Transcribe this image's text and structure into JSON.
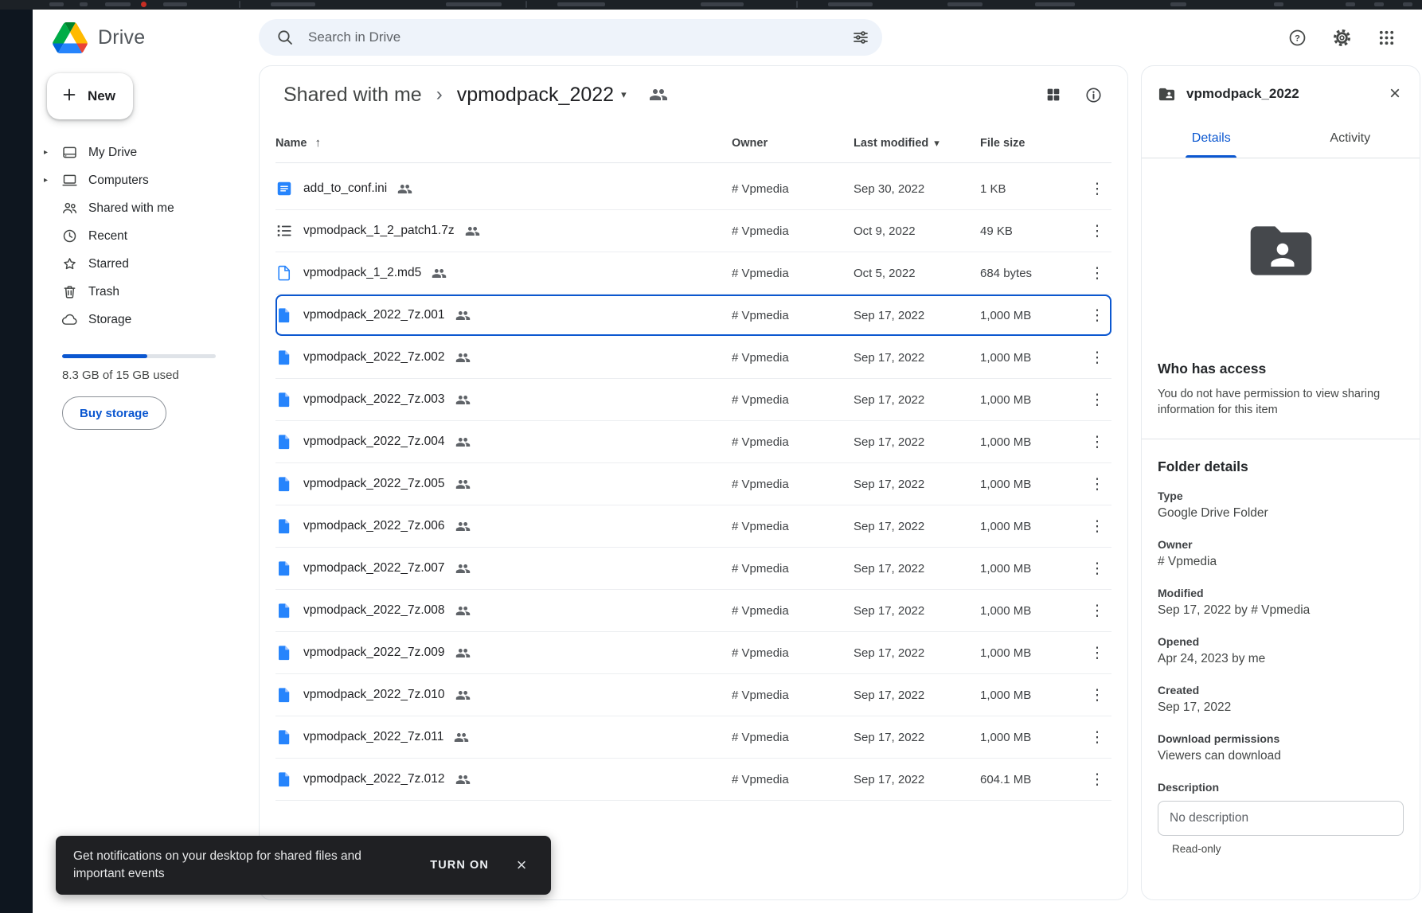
{
  "header": {
    "brand": "Drive",
    "search_placeholder": "Search in Drive"
  },
  "sidebar": {
    "new_button": "New",
    "items": [
      {
        "key": "my-drive",
        "label": "My Drive",
        "icon": "my-drive",
        "expandable": true
      },
      {
        "key": "computers",
        "label": "Computers",
        "icon": "computers",
        "expandable": true
      },
      {
        "key": "shared-with-me",
        "label": "Shared with me",
        "icon": "shared",
        "expandable": false
      },
      {
        "key": "recent",
        "label": "Recent",
        "icon": "recent",
        "expandable": false
      },
      {
        "key": "starred",
        "label": "Starred",
        "icon": "starred",
        "expandable": false
      },
      {
        "key": "trash",
        "label": "Trash",
        "icon": "trash",
        "expandable": false
      },
      {
        "key": "storage",
        "label": "Storage",
        "icon": "storage",
        "expandable": false
      }
    ],
    "storage_fraction": 0.553,
    "storage_text": "8.3 GB of 15 GB used",
    "buy_storage": "Buy storage"
  },
  "breadcrumb": {
    "parent": "Shared with me",
    "current": "vpmodpack_2022"
  },
  "table": {
    "columns": [
      "Name",
      "Owner",
      "Last modified",
      "File size"
    ],
    "rows": [
      {
        "name": "add_to_conf.ini",
        "icon": "doc-lines",
        "shared": true,
        "owner": "# Vpmedia",
        "modified": "Sep 30, 2022",
        "size": "1 KB",
        "selected": false
      },
      {
        "name": "vpmodpack_1_2_patch1.7z",
        "icon": "list",
        "shared": true,
        "owner": "# Vpmedia",
        "modified": "Oct 9, 2022",
        "size": "49 KB",
        "selected": false
      },
      {
        "name": "vpmodpack_1_2.md5",
        "icon": "file-outline",
        "shared": true,
        "owner": "# Vpmedia",
        "modified": "Oct 5, 2022",
        "size": "684 bytes",
        "selected": false
      },
      {
        "name": "vpmodpack_2022_7z.001",
        "icon": "file-solid",
        "shared": true,
        "owner": "# Vpmedia",
        "modified": "Sep 17, 2022",
        "size": "1,000 MB",
        "selected": true
      },
      {
        "name": "vpmodpack_2022_7z.002",
        "icon": "file-solid",
        "shared": true,
        "owner": "# Vpmedia",
        "modified": "Sep 17, 2022",
        "size": "1,000 MB",
        "selected": false
      },
      {
        "name": "vpmodpack_2022_7z.003",
        "icon": "file-solid",
        "shared": true,
        "owner": "# Vpmedia",
        "modified": "Sep 17, 2022",
        "size": "1,000 MB",
        "selected": false
      },
      {
        "name": "vpmodpack_2022_7z.004",
        "icon": "file-solid",
        "shared": true,
        "owner": "# Vpmedia",
        "modified": "Sep 17, 2022",
        "size": "1,000 MB",
        "selected": false
      },
      {
        "name": "vpmodpack_2022_7z.005",
        "icon": "file-solid",
        "shared": true,
        "owner": "# Vpmedia",
        "modified": "Sep 17, 2022",
        "size": "1,000 MB",
        "selected": false
      },
      {
        "name": "vpmodpack_2022_7z.006",
        "icon": "file-solid",
        "shared": true,
        "owner": "# Vpmedia",
        "modified": "Sep 17, 2022",
        "size": "1,000 MB",
        "selected": false
      },
      {
        "name": "vpmodpack_2022_7z.007",
        "icon": "file-solid",
        "shared": true,
        "owner": "# Vpmedia",
        "modified": "Sep 17, 2022",
        "size": "1,000 MB",
        "selected": false
      },
      {
        "name": "vpmodpack_2022_7z.008",
        "icon": "file-solid",
        "shared": true,
        "owner": "# Vpmedia",
        "modified": "Sep 17, 2022",
        "size": "1,000 MB",
        "selected": false
      },
      {
        "name": "vpmodpack_2022_7z.009",
        "icon": "file-solid",
        "shared": true,
        "owner": "# Vpmedia",
        "modified": "Sep 17, 2022",
        "size": "1,000 MB",
        "selected": false
      },
      {
        "name": "vpmodpack_2022_7z.010",
        "icon": "file-solid",
        "shared": true,
        "owner": "# Vpmedia",
        "modified": "Sep 17, 2022",
        "size": "1,000 MB",
        "selected": false
      },
      {
        "name": "vpmodpack_2022_7z.011",
        "icon": "file-solid",
        "shared": true,
        "owner": "# Vpmedia",
        "modified": "Sep 17, 2022",
        "size": "1,000 MB",
        "selected": false
      },
      {
        "name": "vpmodpack_2022_7z.012",
        "icon": "file-solid",
        "shared": true,
        "owner": "# Vpmedia",
        "modified": "Sep 17, 2022",
        "size": "604.1 MB",
        "selected": false
      }
    ]
  },
  "panel": {
    "title": "vpmodpack_2022",
    "tabs": [
      {
        "label": "Details",
        "active": true
      },
      {
        "label": "Activity",
        "active": false
      }
    ],
    "who_has_access": "Who has access",
    "access_message": "You do not have permission to view sharing information for this item",
    "folder_details_heading": "Folder details",
    "fields": [
      {
        "label": "Type",
        "value": "Google Drive Folder"
      },
      {
        "label": "Owner",
        "value": "# Vpmedia"
      },
      {
        "label": "Modified",
        "value": "Sep 17, 2022 by # Vpmedia"
      },
      {
        "label": "Opened",
        "value": "Apr 24, 2023 by me"
      },
      {
        "label": "Created",
        "value": "Sep 17, 2022"
      },
      {
        "label": "Download permissions",
        "value": "Viewers can download"
      }
    ],
    "description_label": "Description",
    "description_placeholder": "No description",
    "read_only": "Read-only"
  },
  "toast": {
    "message": "Get notifications on your desktop for shared files and important events",
    "action": "TURN ON"
  },
  "glyphs": {
    "sort_asc": "↑",
    "caret_down": "▾",
    "chevron_right": "▸",
    "crumb_separator": "›",
    "more_vertical": "⋮",
    "close": "×"
  },
  "colors": {
    "accent": "#0b57d0",
    "file_icon_blue": "#2684fc",
    "selected_outline": "#0b57d0",
    "toast_background": "#1f2023"
  }
}
